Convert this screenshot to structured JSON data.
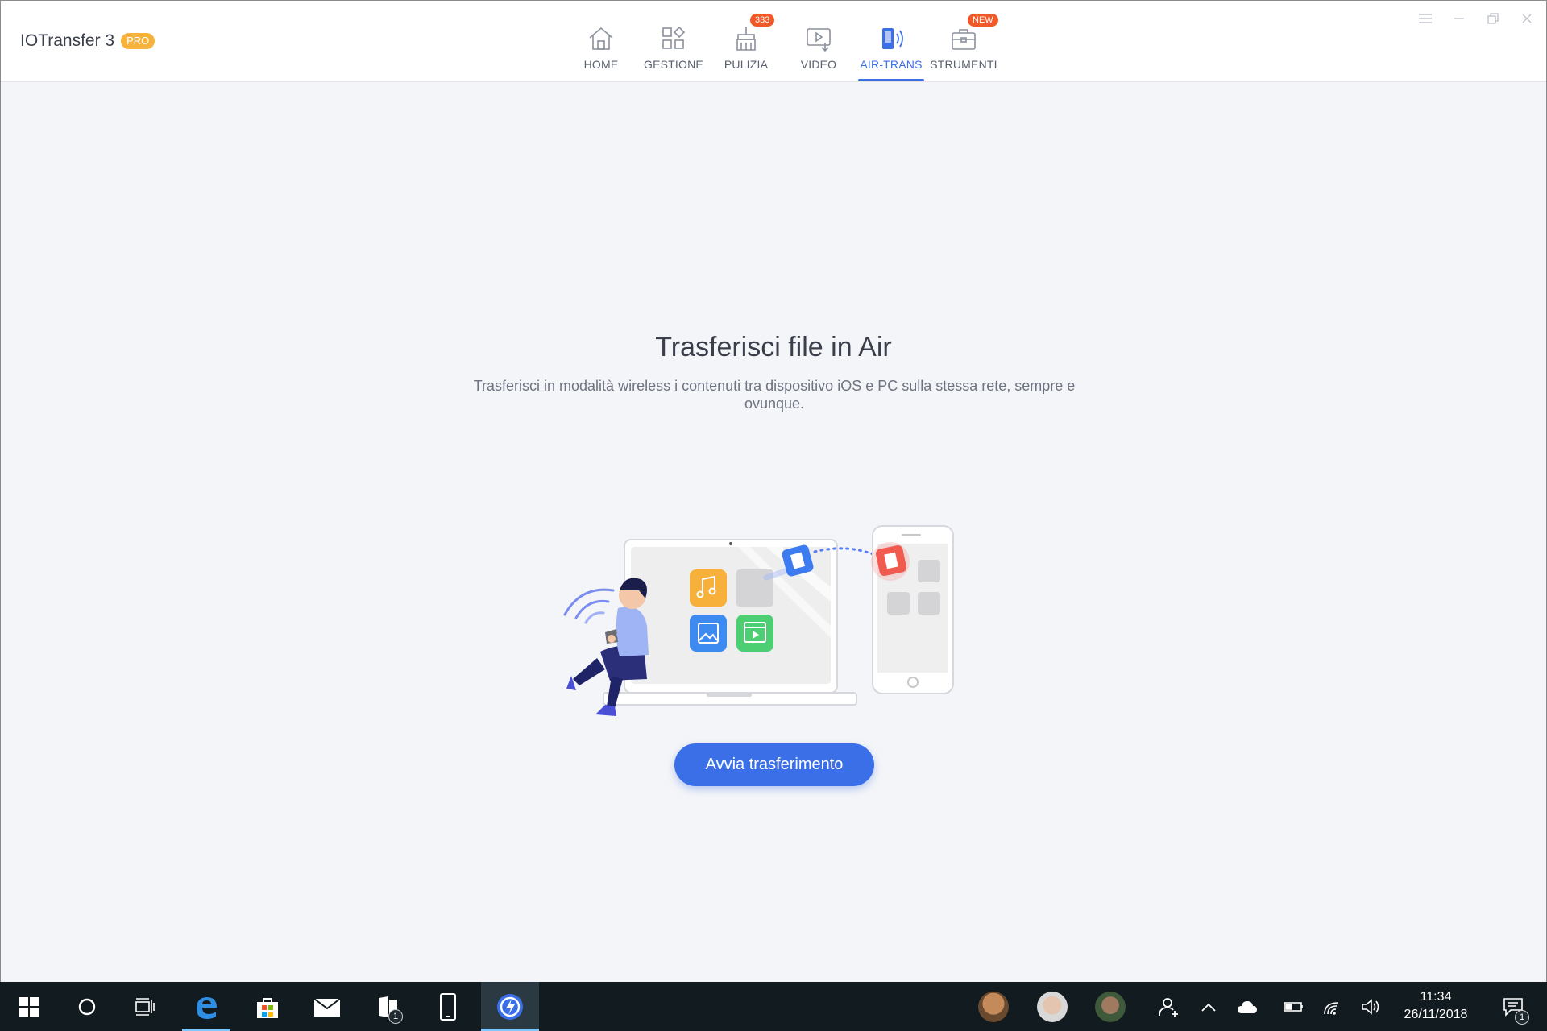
{
  "app": {
    "title": "IOTransfer 3",
    "badge": "PRO"
  },
  "nav": {
    "items": [
      {
        "label": "HOME",
        "icon": "home-icon",
        "active": false
      },
      {
        "label": "GESTIONE",
        "icon": "grid-icon",
        "active": false
      },
      {
        "label": "PULIZIA",
        "icon": "broom-icon",
        "badge": "333",
        "active": false
      },
      {
        "label": "VIDEO",
        "icon": "video-download-icon",
        "active": false
      },
      {
        "label": "AIR-TRANS",
        "icon": "phone-wireless-icon",
        "active": true
      },
      {
        "label": "STRUMENTI",
        "icon": "toolbox-icon",
        "badge": "NEW",
        "active": false
      }
    ]
  },
  "main": {
    "title": "Trasferisci file in Air",
    "description": "Trasferisci in modalità wireless i contenuti tra dispositivo iOS e PC sulla stessa rete, sempre e ovunque.",
    "cta_label": "Avvia trasferimento"
  },
  "taskbar": {
    "time": "11:34",
    "date": "26/11/2018",
    "explorer_count": "1",
    "notification_count": "1"
  },
  "colors": {
    "accent": "#3a6fe8",
    "pro_badge": "#f6b23a",
    "badge": "#f05a28",
    "taskbar": "#111b20"
  }
}
